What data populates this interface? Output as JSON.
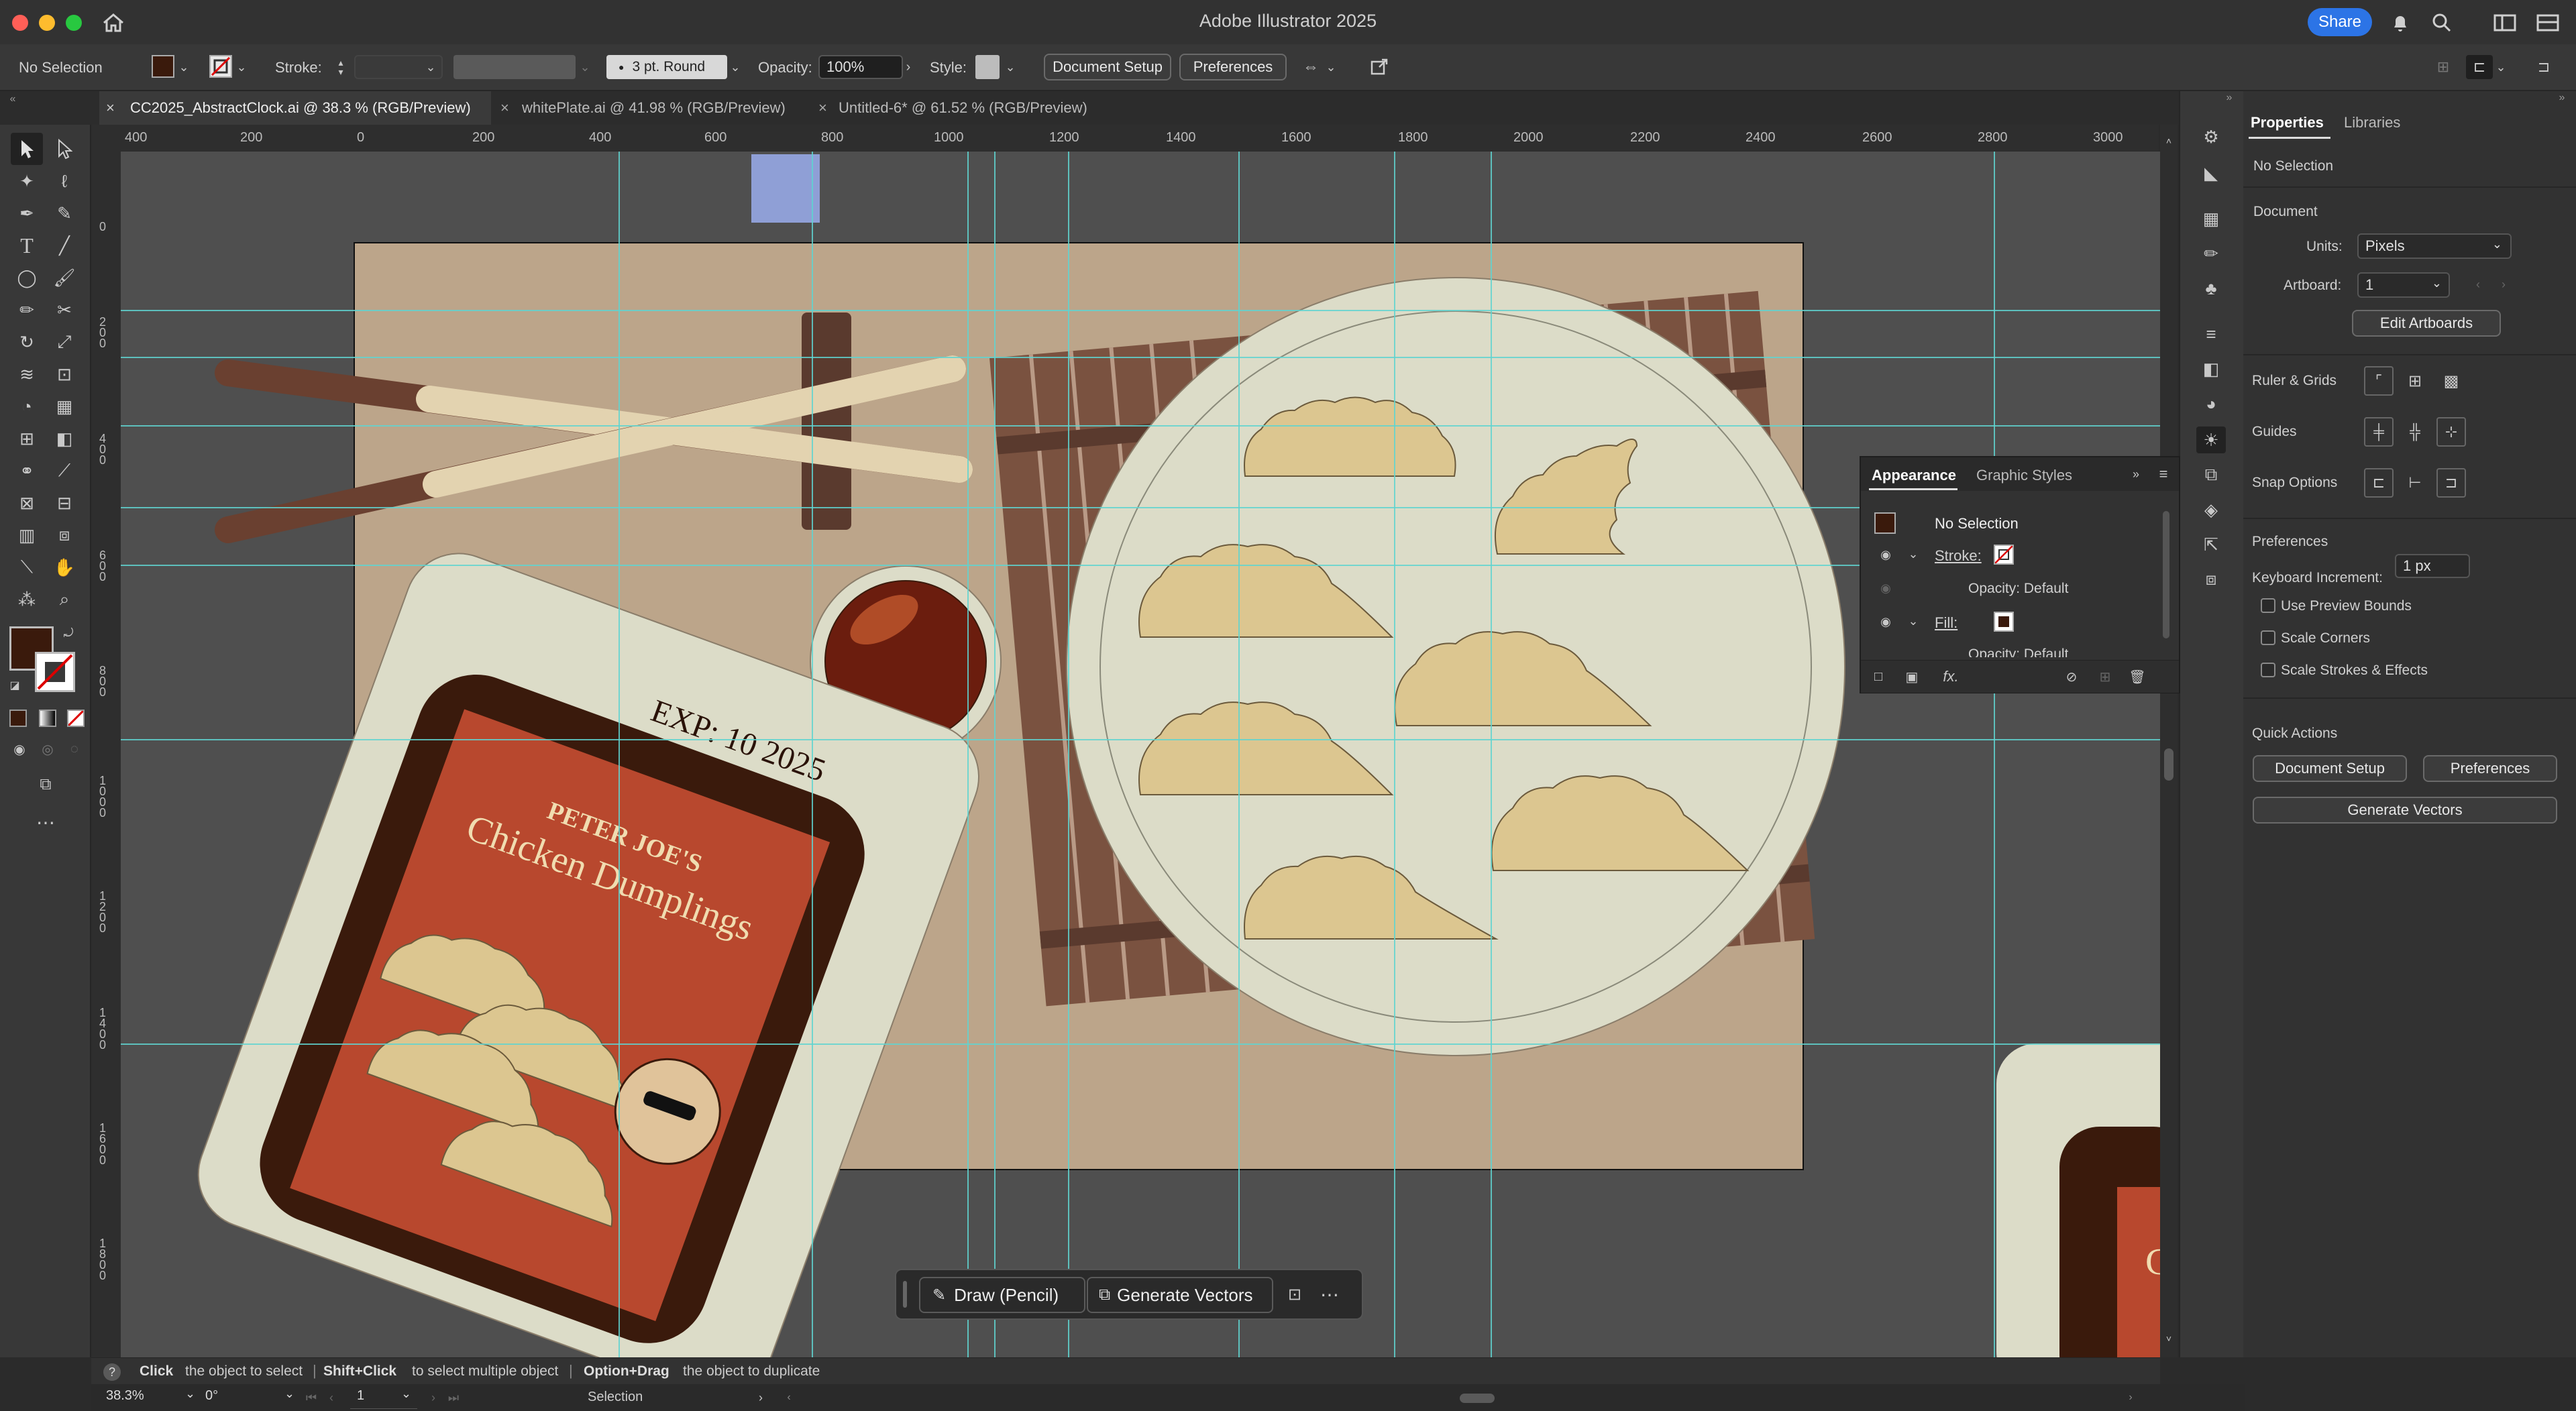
{
  "app": {
    "title": "Adobe Illustrator 2025",
    "share_label": "Share"
  },
  "control_bar": {
    "selection": "No Selection",
    "stroke_label": "Stroke:",
    "brush_label": "3 pt. Round",
    "opacity_label": "Opacity:",
    "opacity_value": "100%",
    "style_label": "Style:",
    "doc_setup_label": "Document Setup",
    "preferences_label": "Preferences"
  },
  "tabs": [
    {
      "label": "CC2025_AbstractClock.ai @ 38.3 % (RGB/Preview)"
    },
    {
      "label": "whitePlate.ai @ 41.98 % (RGB/Preview)"
    },
    {
      "label": "Untitled-6* @ 61.52 % (RGB/Preview)"
    }
  ],
  "ruler": {
    "top": [
      "400",
      "200",
      "0",
      "200",
      "400",
      "600",
      "800",
      "1000",
      "1200",
      "1400",
      "1600",
      "1800",
      "2000",
      "2200",
      "2400",
      "2600",
      "2800",
      "3000"
    ],
    "left": [
      "0",
      "2\n0\n0",
      "4\n0\n0",
      "6\n0\n0",
      "8\n0\n0",
      "1\n0\n0\n0",
      "1\n2\n0\n0",
      "1\n4\n0\n0",
      "1\n6\n0\n0",
      "1\n8\n0\n0"
    ]
  },
  "artwork": {
    "exp_text": "EXP: 10 2025",
    "brand_text": "PETER JOE'S",
    "product_text": "Chicken Dumplings",
    "partial_letter": "C"
  },
  "floating_bar": {
    "draw_label": "Draw (Pencil)",
    "generate_label": "Generate Vectors"
  },
  "appearance_panel": {
    "tab_active": "Appearance",
    "tab_other": "Graphic Styles",
    "selection": "No Selection",
    "stroke_label": "Stroke:",
    "stroke_opacity": "Opacity: Default",
    "fill_label": "Fill:",
    "fill_opacity": "Opacity: Default"
  },
  "properties": {
    "tab_active": "Properties",
    "tab_other": "Libraries",
    "selection": "No Selection",
    "document_heading": "Document",
    "units_label": "Units:",
    "units_value": "Pixels",
    "artboard_label": "Artboard:",
    "artboard_value": "1",
    "edit_artboards": "Edit Artboards",
    "ruler_grids": "Ruler & Grids",
    "guides": "Guides",
    "snap_options": "Snap Options",
    "preferences_heading": "Preferences",
    "keyboard_increment_label": "Keyboard Increment:",
    "keyboard_increment_value": "1 px",
    "use_preview_bounds": "Use Preview Bounds",
    "scale_corners": "Scale Corners",
    "scale_strokes": "Scale Strokes & Effects",
    "quick_actions": "Quick Actions",
    "doc_setup": "Document Setup",
    "preferences": "Preferences",
    "generate_vectors": "Generate Vectors"
  },
  "status": {
    "hint_click": "Click",
    "hint_click_text": "the object to select",
    "hint_shift": "Shift+Click",
    "hint_shift_text": "to select multiple object",
    "hint_option": "Option+Drag",
    "hint_option_text": "the object to duplicate",
    "zoom": "38.3%",
    "rotation": "0°",
    "artboard_num": "1",
    "tool_name": "Selection"
  },
  "colors": {
    "fill_swatch": "#3a1a0c",
    "artboard": "#bca58a",
    "plate": "#dcdcc8",
    "dumpling": "#dcc690",
    "package": "#b8482e",
    "dark_brown": "#3a1a0c",
    "guide": "#5fd3d0",
    "accent": "#2c74e6"
  }
}
